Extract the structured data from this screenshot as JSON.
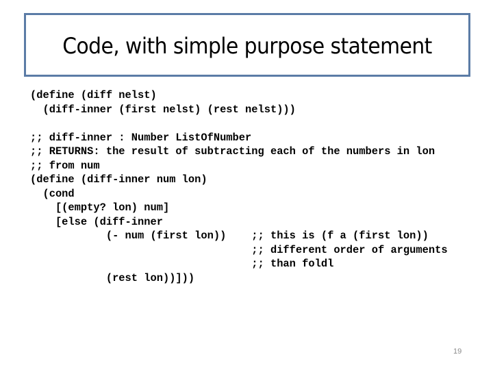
{
  "slide": {
    "title": "Code, with simple purpose statement",
    "code_lines": [
      "(define (diff nelst)",
      "  (diff-inner (first nelst) (rest nelst)))",
      "",
      ";; diff-inner : Number ListOfNumber",
      ";; RETURNS: the result of subtracting each of the numbers in lon",
      ";; from num",
      "(define (diff-inner num lon)",
      "  (cond",
      "    [(empty? lon) num]",
      "    [else (diff-inner",
      "            (- num (first lon))    ;; this is (f a (first lon))",
      "                                   ;; different order of arguments",
      "                                   ;; than foldl",
      "            (rest lon))]))"
    ],
    "slide_number": "19"
  },
  "colors": {
    "title_border": "#5b7ca6",
    "text": "#000000",
    "slide_number": "#8b8b8b"
  }
}
